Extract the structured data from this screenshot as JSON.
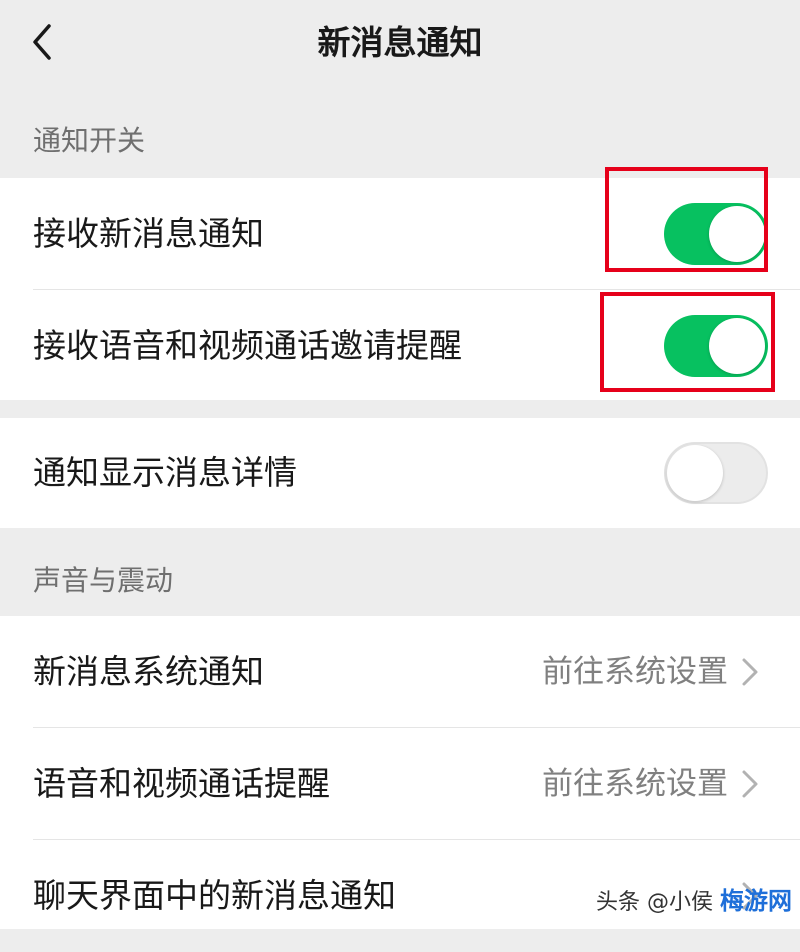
{
  "nav": {
    "title": "新消息通知"
  },
  "sections": {
    "notify_header": "通知开关",
    "sound_header": "声音与震动"
  },
  "notify_group": {
    "items": [
      {
        "label": "接收新消息通知",
        "toggle": "on"
      },
      {
        "label": "接收语音和视频通话邀请提醒",
        "toggle": "on"
      }
    ]
  },
  "detail_group": {
    "items": [
      {
        "label": "通知显示消息详情",
        "toggle": "off"
      }
    ]
  },
  "sound_group": {
    "items": [
      {
        "label": "新消息系统通知",
        "value": "前往系统设置"
      },
      {
        "label": "语音和视频通话提醒",
        "value": "前往系统设置"
      },
      {
        "label": "聊天界面中的新消息通知"
      }
    ]
  },
  "watermark": {
    "author": "头条 @小侯",
    "site": "梅游网"
  },
  "colors": {
    "switch_on": "#07c160",
    "highlight": "#e6001a",
    "background": "#ededed"
  },
  "icons": {
    "back": "chevron-left-icon",
    "row_arrow": "chevron-right-icon"
  }
}
